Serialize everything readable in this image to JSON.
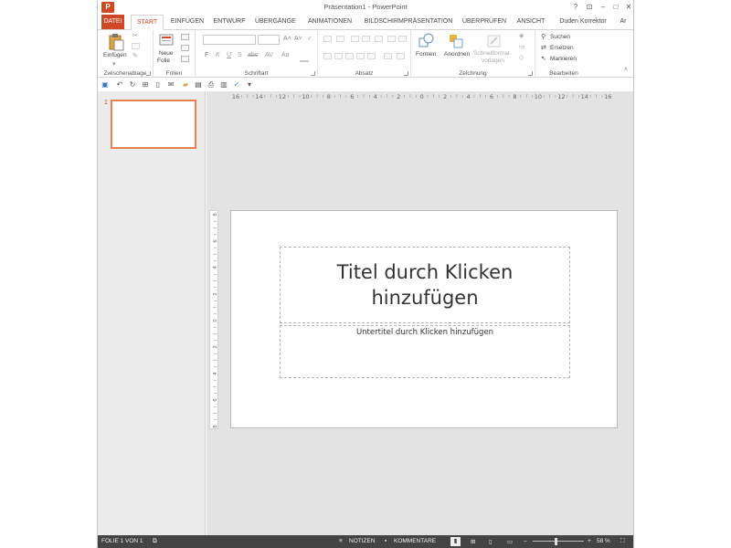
{
  "window": {
    "title": "Präsentation1 - PowerPoint",
    "app_icon": "P",
    "buttons": {
      "help": "?",
      "restore_ribbon": "⊡",
      "minimize": "–",
      "maximize": "□",
      "close": "✕"
    }
  },
  "tabs": [
    {
      "label": "DATEI"
    },
    {
      "label": "START"
    },
    {
      "label": "EINFÜGEN"
    },
    {
      "label": "ENTWURF"
    },
    {
      "label": "ÜBERGÄNGE"
    },
    {
      "label": "ANIMATIONEN"
    },
    {
      "label": "BILDSCHIRMPRÄSENTATION"
    },
    {
      "label": "ÜBERPRÜFEN"
    },
    {
      "label": "ANSICHT"
    },
    {
      "label": "Duden Korrektor"
    },
    {
      "label": "Ar"
    }
  ],
  "ribbon": {
    "clipboard": {
      "group": "Zwischenablage",
      "paste": "Einfügen"
    },
    "slides": {
      "group": "Folien",
      "new_slide_1": "Neue",
      "new_slide_2": "Folie"
    },
    "font": {
      "group": "Schriftart",
      "bold": "F",
      "italic": "K",
      "underline": "U",
      "strike": "S",
      "shadow": "abc",
      "spacing": "AV",
      "case": "Aa",
      "grow": "A˄",
      "shrink": "A˅",
      "clear": "✓"
    },
    "paragraph": {
      "group": "Absatz"
    },
    "drawing": {
      "group": "Zeichnung",
      "shapes": "Formen",
      "arrange": "Anordnen",
      "quick_styles_1": "Schnellformat-",
      "quick_styles_2": "vorlagen"
    },
    "editing": {
      "group": "Bearbeiten",
      "find": "Suchen",
      "replace": "Ersetzen",
      "select": "Markieren"
    }
  },
  "ruler": {
    "h_labels": [
      "16",
      "14",
      "12",
      "10",
      "8",
      "6",
      "4",
      "2",
      "0",
      "2",
      "4",
      "6",
      "8",
      "10",
      "12",
      "14",
      "16"
    ],
    "v_labels": [
      "8",
      "6",
      "4",
      "2",
      "0",
      "2",
      "4",
      "6",
      "8"
    ]
  },
  "slides_panel": {
    "slide_number": "1"
  },
  "slide": {
    "title_placeholder": "Titel durch Klicken hinzufügen",
    "subtitle_placeholder": "Untertitel durch Klicken hinzufügen"
  },
  "status": {
    "slide_info": "FOLIE 1 VON 1",
    "notes": "NOTIZEN",
    "comments": "KOMMENTARE",
    "zoom": "58 %"
  },
  "colors": {
    "accent": "#d24726",
    "thumb_border": "#e8804f",
    "status_bg": "#444444"
  }
}
